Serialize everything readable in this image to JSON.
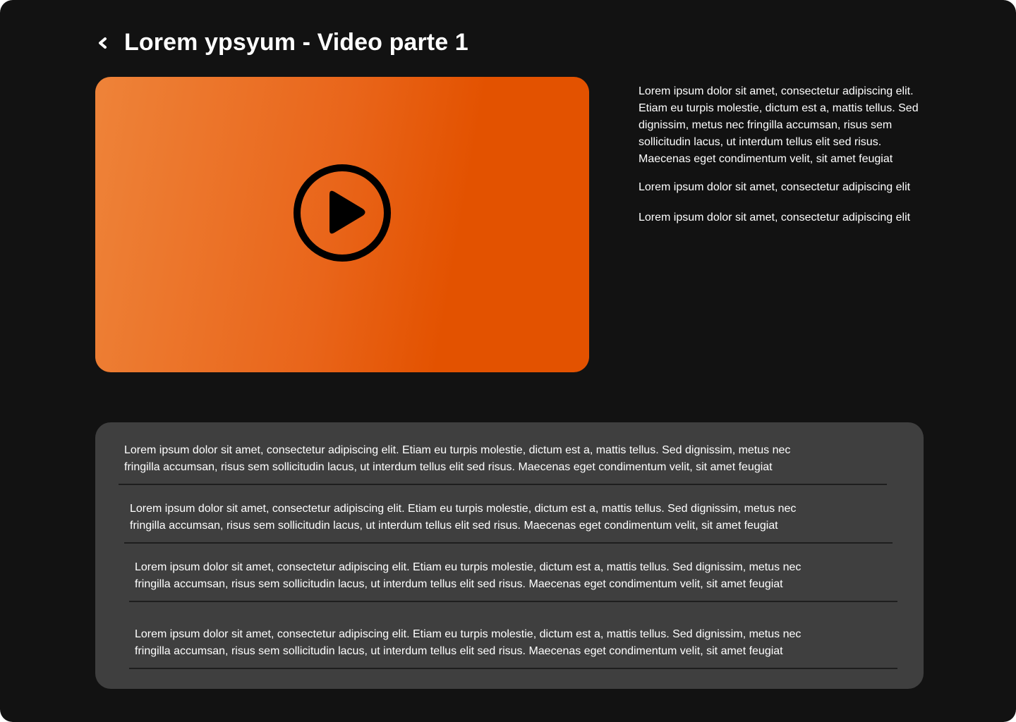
{
  "header": {
    "back_icon": "chevron-left-icon",
    "title": "Lorem ypsyum - Video parte 1"
  },
  "video": {
    "play_icon": "play-circle-icon",
    "gradient_start": "#ee8339",
    "gradient_end": "#e35200"
  },
  "description": {
    "paragraphs": [
      "Lorem ipsum dolor sit amet, consectetur adipiscing elit. Etiam eu turpis molestie, dictum est a, mattis tellus. Sed dignissim, metus nec fringilla accumsan, risus sem sollicitudin lacus, ut interdum tellus elit sed risus. Maecenas eget condimentum velit, sit amet feugiat",
      "Lorem ipsum dolor sit amet, consectetur adipiscing elit",
      "Lorem ipsum dolor sit amet, consectetur adipiscing elit"
    ]
  },
  "list": {
    "items": [
      {
        "line1": "Lorem ipsum dolor sit amet, consectetur adipiscing elit. Etiam eu turpis molestie, dictum est a, mattis tellus. Sed dignissim, metus nec",
        "line2": "fringilla accumsan, risus sem sollicitudin lacus, ut interdum tellus elit sed risus. Maecenas eget condimentum velit, sit amet feugiat"
      },
      {
        "line1": "Lorem ipsum dolor sit amet, consectetur adipiscing elit. Etiam eu turpis molestie, dictum est a, mattis tellus. Sed dignissim, metus nec",
        "line2": "fringilla accumsan, risus sem sollicitudin lacus, ut interdum tellus elit sed risus. Maecenas eget condimentum velit, sit amet feugiat"
      },
      {
        "line1": "Lorem ipsum dolor sit amet, consectetur adipiscing elit. Etiam eu turpis molestie, dictum est a, mattis tellus. Sed dignissim, metus nec",
        "line2": "fringilla accumsan, risus sem sollicitudin lacus, ut interdum tellus elit sed risus. Maecenas eget condimentum velit, sit amet feugiat"
      },
      {
        "line1": "Lorem ipsum dolor sit amet, consectetur adipiscing elit. Etiam eu turpis molestie, dictum est a, mattis tellus. Sed dignissim, metus nec",
        "line2": "fringilla accumsan, risus sem sollicitudin lacus, ut interdum tellus elit sed risus. Maecenas eget condimentum velit, sit amet feugiat"
      }
    ]
  },
  "colors": {
    "background": "#121212",
    "panel": "#3f3f3f",
    "divider": "#1e1e1e",
    "text": "#ffffff",
    "accent": "#e35200"
  }
}
